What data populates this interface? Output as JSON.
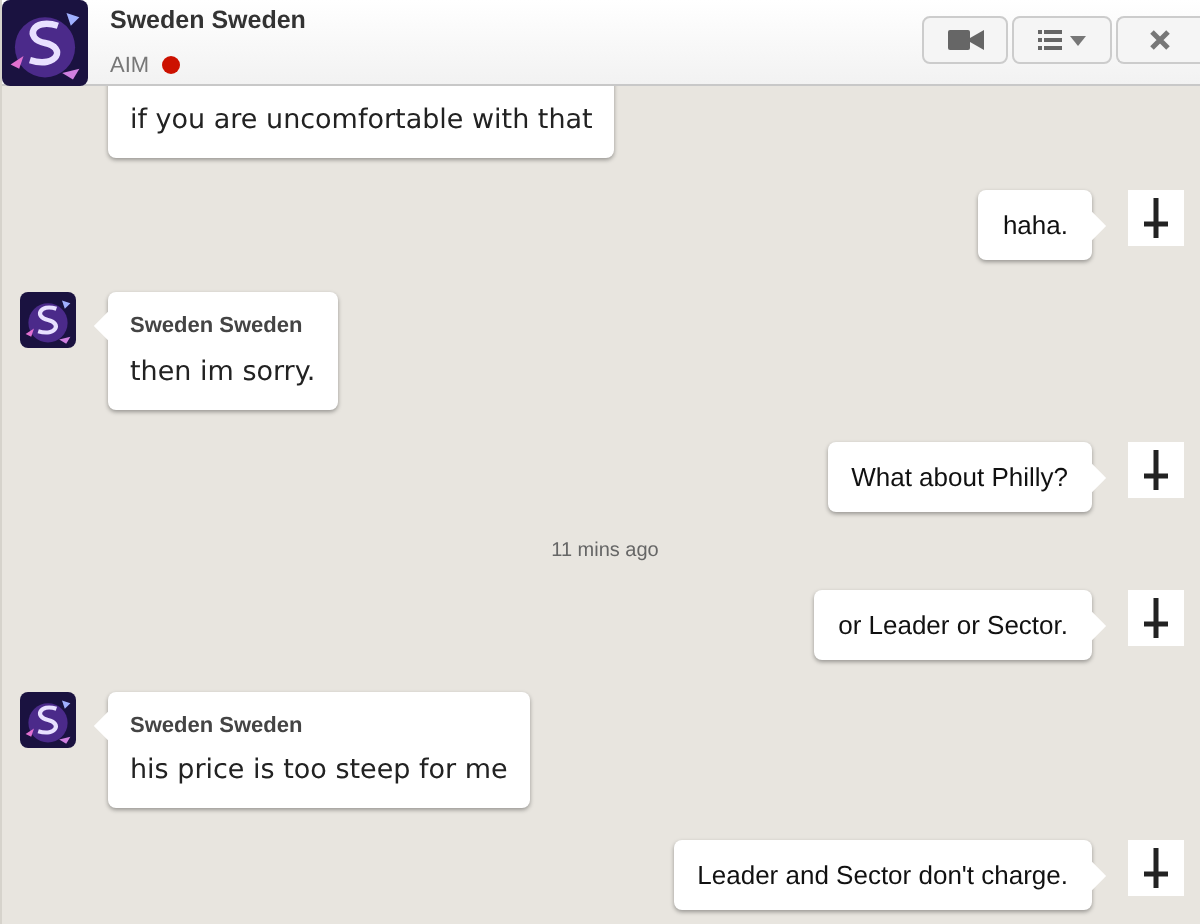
{
  "header": {
    "name": "Sweden Sweden",
    "service": "AIM",
    "status_dot": {
      "color": "#cc1100"
    }
  },
  "messages": [
    {
      "kind": "incoming_continued",
      "lines": [
        "if you are uncomfortable with that"
      ]
    },
    {
      "kind": "outgoing",
      "lines": [
        "haha."
      ]
    },
    {
      "kind": "incoming",
      "sender": "Sweden Sweden",
      "lines": [
        "then im sorry."
      ]
    },
    {
      "kind": "outgoing",
      "lines": [
        "What about Philly?"
      ]
    },
    {
      "kind": "timestamp",
      "text": "11 mins ago"
    },
    {
      "kind": "outgoing",
      "lines": [
        "or Leader or Sector."
      ]
    },
    {
      "kind": "incoming",
      "sender": "Sweden Sweden",
      "lines": [
        "his price is too steep for me"
      ]
    },
    {
      "kind": "outgoing",
      "lines": [
        "Leader and Sector don't charge."
      ]
    }
  ]
}
